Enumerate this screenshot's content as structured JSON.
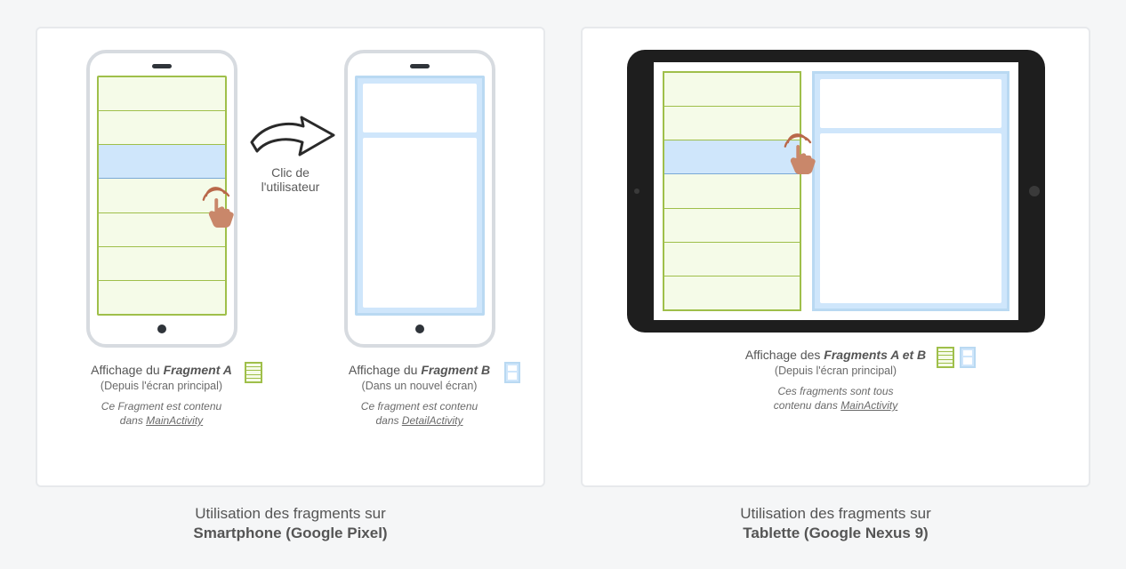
{
  "flow": {
    "click_label_line1": "Clic de",
    "click_label_line2": "l'utilisateur"
  },
  "phone": {
    "fragA": {
      "title_pre": "Affichage du ",
      "title_em": "Fragment A",
      "sub": "(Depuis l'écran principal)",
      "note_pre": "Ce Fragment est contenu",
      "note_mid": "dans ",
      "note_activity": "MainActivity"
    },
    "fragB": {
      "title_pre": "Affichage du ",
      "title_em": "Fragment B",
      "sub": "(Dans un nouvel écran)",
      "note_pre": "Ce fragment est contenu",
      "note_mid": "dans ",
      "note_activity": "DetailActivity"
    },
    "caption_line1": "Utilisation des fragments sur",
    "caption_line2": "Smartphone (Google Pixel)"
  },
  "tablet": {
    "frag": {
      "title_pre": "Affichage des ",
      "title_em": "Fragments A et B",
      "sub": "(Depuis l'écran principal)",
      "note_pre": "Ces fragments sont tous",
      "note_mid": "contenu dans ",
      "note_activity": "MainActivity"
    },
    "caption_line1": "Utilisation des fragments sur",
    "caption_line2": "Tablette (Google Nexus 9)"
  }
}
